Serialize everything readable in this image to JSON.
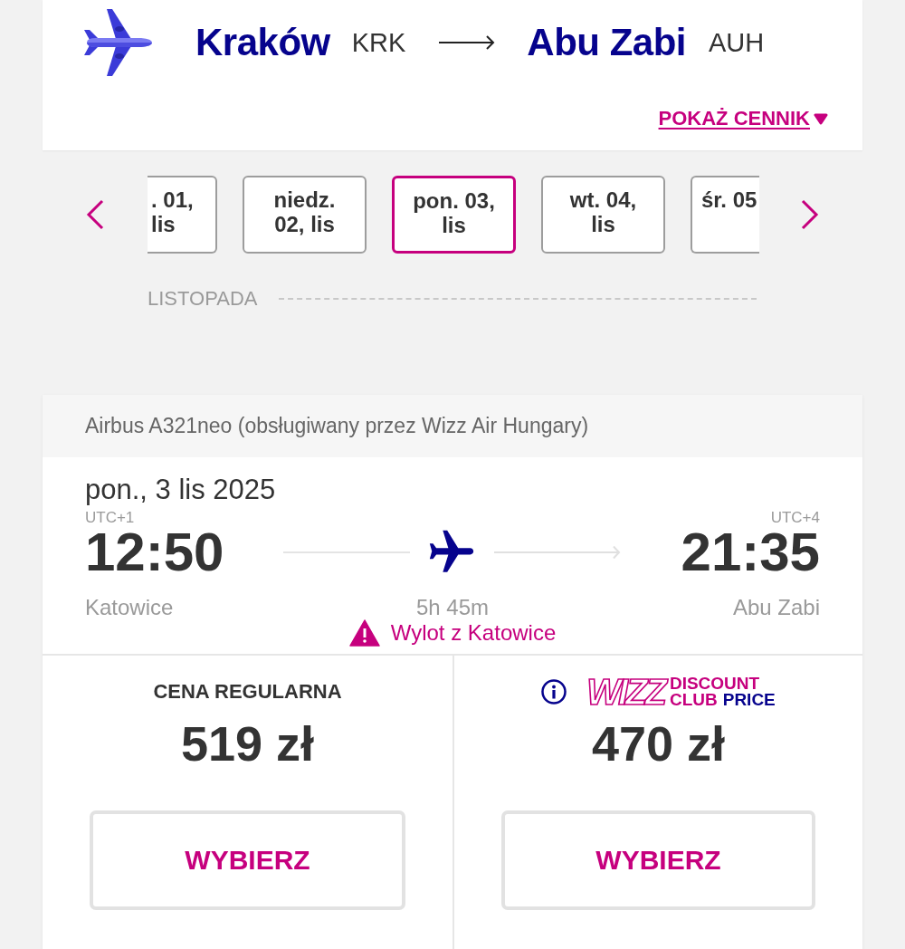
{
  "route": {
    "origin_city": "Kraków",
    "origin_code": "KRK",
    "destination_city": "Abu Zabi",
    "destination_code": "AUH",
    "price_link": "POKAŻ CENNIK"
  },
  "dates": {
    "items": [
      {
        "lines": [
          ". 01,",
          "lis"
        ],
        "selected": false
      },
      {
        "lines": [
          "niedz.",
          "02, lis"
        ],
        "selected": false
      },
      {
        "lines": [
          "pon. 03,",
          "lis"
        ],
        "selected": true
      },
      {
        "lines": [
          "wt. 04,",
          "lis"
        ],
        "selected": false
      },
      {
        "lines": [
          "śr. 05"
        ],
        "selected": false
      }
    ],
    "month": "LISTOPADA"
  },
  "flight": {
    "aircraft": "Airbus A321neo (obsługiwany przez Wizz Air Hungary)",
    "date": "pon., 3 lis 2025",
    "departure": {
      "timezone": "UTC+1",
      "time": "12:50",
      "city": "Katowice"
    },
    "duration": "5h 45m",
    "arrival": {
      "timezone": "UTC+4",
      "time": "21:35",
      "city": "Abu Zabi"
    },
    "warning": "Wylot z Katowice"
  },
  "fares": [
    {
      "kind": "regular",
      "title": "CENA REGULARNA",
      "price": "519 zł",
      "button": "WYBIERZ"
    },
    {
      "kind": "club",
      "badge": {
        "wordmark": "WIZZ",
        "line_1": "DISCOUNT",
        "line_2": "CLUB",
        "line_2_accent": "PRICE"
      },
      "price": "470 zł",
      "button": "WYBIERZ"
    }
  ]
}
